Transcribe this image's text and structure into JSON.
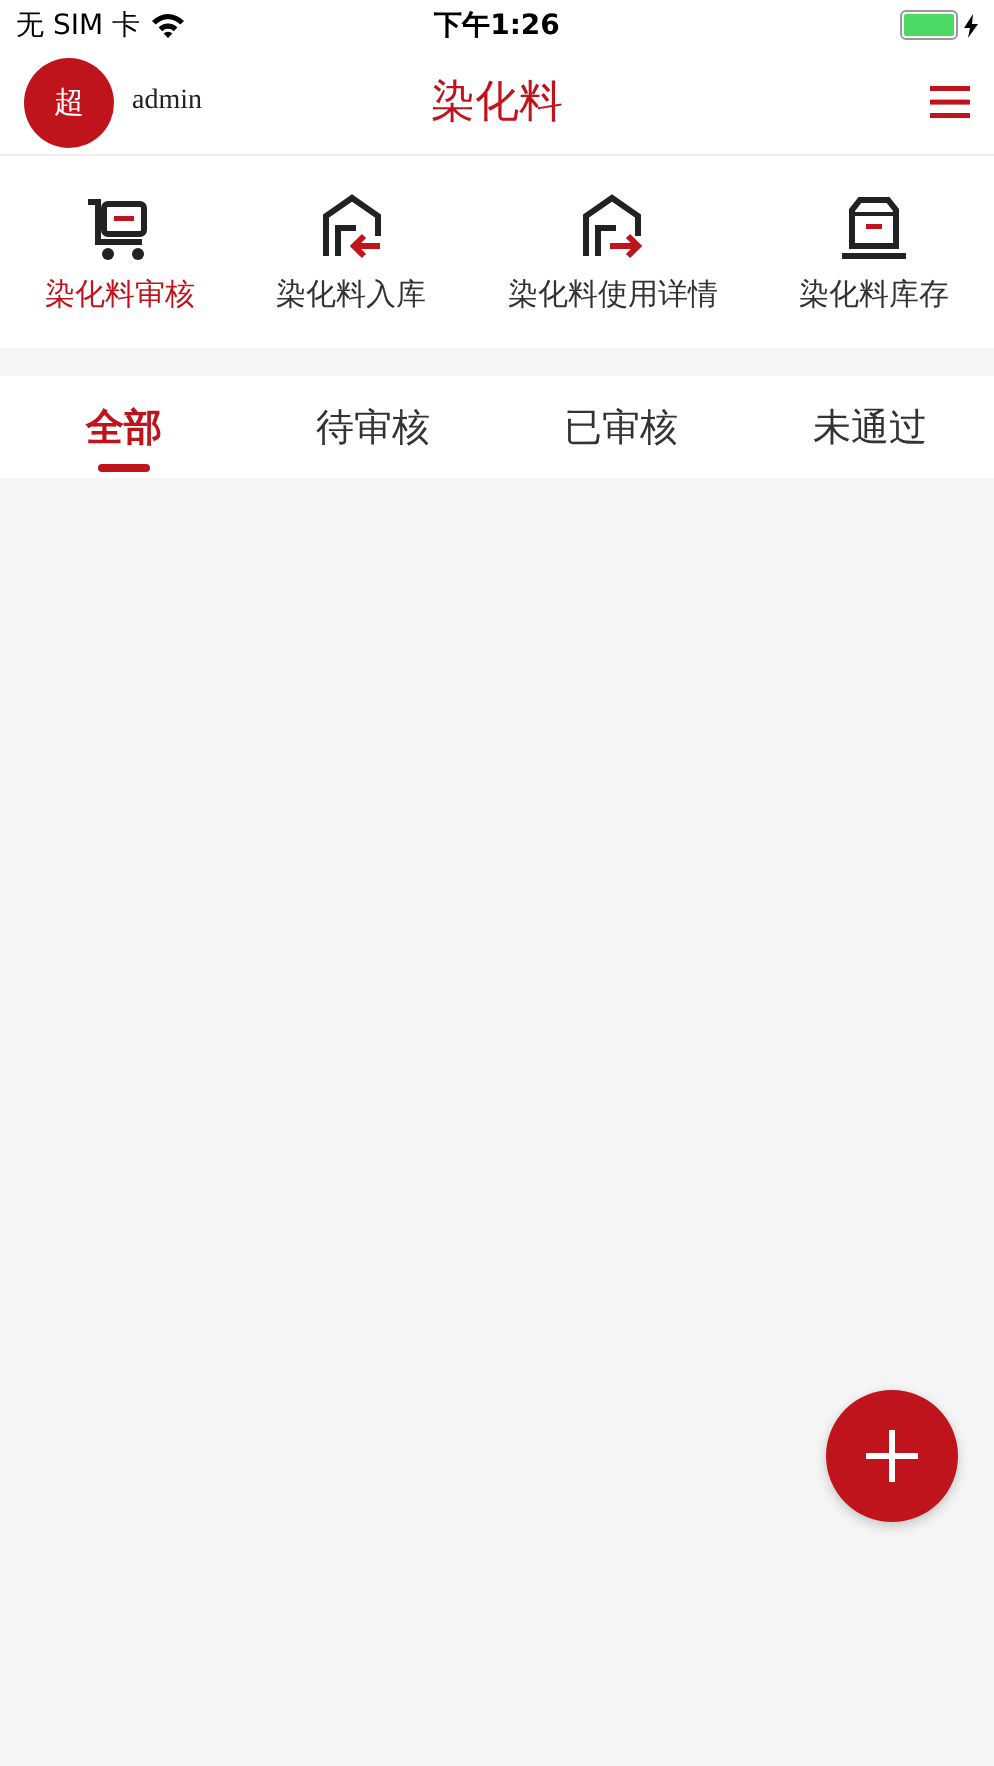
{
  "status_bar": {
    "carrier": "无 SIM 卡",
    "time": "下午1:26"
  },
  "header": {
    "avatar": "超",
    "user": "admin",
    "title": "染化料"
  },
  "shortcuts": [
    {
      "label": "染化料审核",
      "kind": "cart",
      "selected": true
    },
    {
      "label": "染化料入库",
      "kind": "inbound",
      "selected": false
    },
    {
      "label": "染化料使用详情",
      "kind": "outbound",
      "selected": false
    },
    {
      "label": "染化料库存",
      "kind": "box",
      "selected": false
    }
  ],
  "tabs": [
    {
      "label": "全部",
      "selected": true
    },
    {
      "label": "待审核",
      "selected": false
    },
    {
      "label": "已审核",
      "selected": false
    },
    {
      "label": "未通过",
      "selected": false
    }
  ]
}
